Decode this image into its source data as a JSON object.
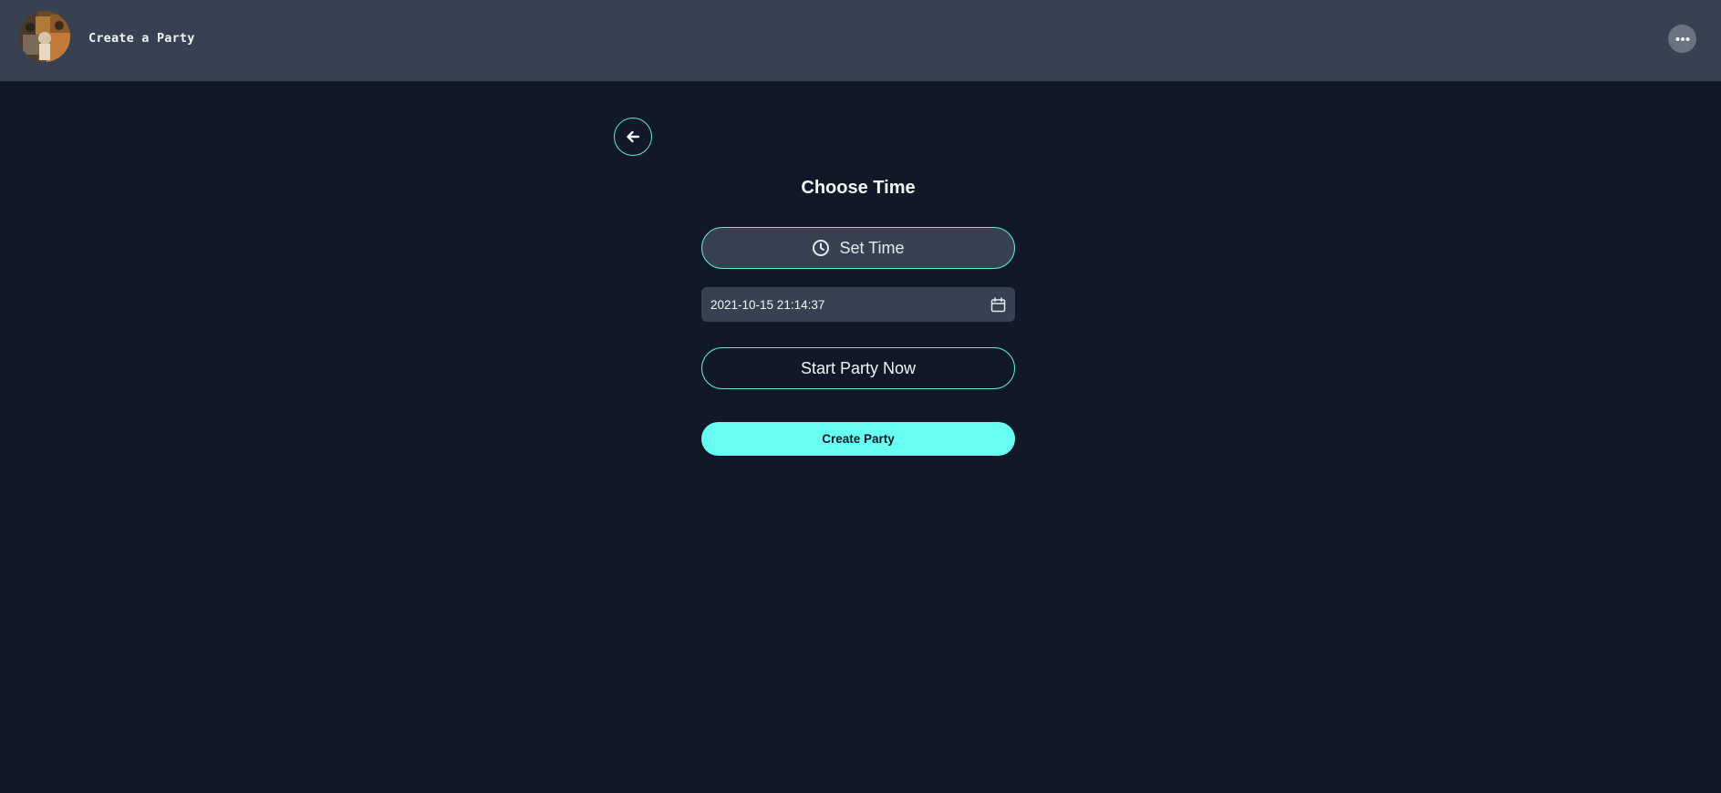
{
  "header": {
    "title": "Create a Party",
    "avatar_icon": "avatar-image",
    "more_icon": "more-horizontal-icon"
  },
  "main": {
    "back_icon": "arrow-left-icon",
    "heading": "Choose Time",
    "set_time_label": "Set Time",
    "set_time_icon": "clock-icon",
    "datetime_value": "2021-10-15 21:14:37",
    "calendar_icon": "calendar-icon",
    "start_now_label": "Start Party Now",
    "create_label": "Create Party"
  },
  "colors": {
    "background": "#111827",
    "topbar": "#374151",
    "accent": "#5eead4",
    "primary_button": "#67fdf1",
    "field": "#374151"
  }
}
